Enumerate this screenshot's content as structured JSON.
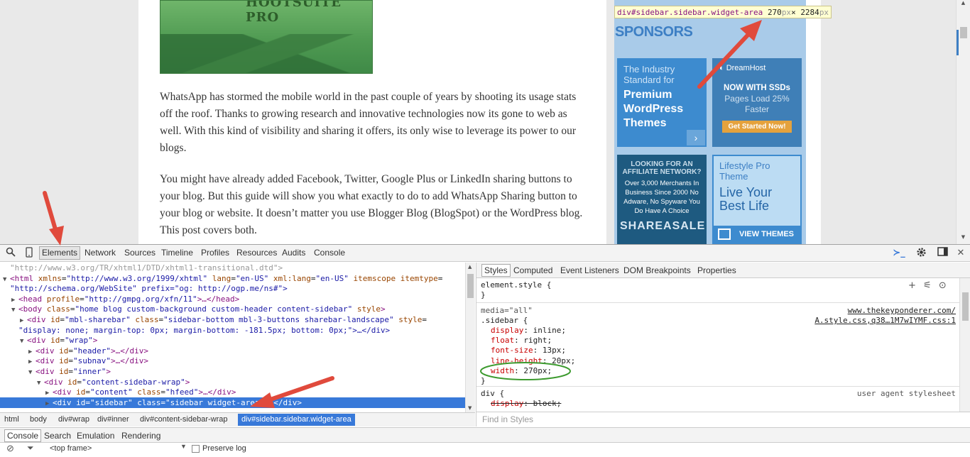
{
  "page": {
    "hero_text": "HOOTSUITE PRO",
    "paragraphs": [
      "WhatsApp has stormed the mobile world in the past couple of years by shooting its usage stats off the roof. Thanks to growing research and innovative technologies now its gone to web as well. With this kind of visibility and sharing it offers, its only wise to leverage its power to our blogs.",
      "You might have already added Facebook, Twitter, Google Plus or LinkedIn sharing buttons to your blog. But this guide will show you what exactly to do to add WhatsApp Sharing button to your blog or website. It doesn’t matter you use Blogger Blog (BlogSpot) or the WordPress blog. This post covers both."
    ],
    "tooltip": {
      "selector": "div#sidebar.sidebar.widget-area",
      "width": "270",
      "height": "2284",
      "unit": "px",
      "times": "×"
    },
    "sponsors_heading": "SPONSORS",
    "ads": {
      "ad1": {
        "t1": "The Industry Standard for",
        "t2": "Premium WordPress Themes",
        "arrow": "›"
      },
      "ad2": {
        "logo": "◐ DreamHost",
        "t1": "NOW WITH SSDs",
        "t2": "Pages Load 25% Faster",
        "btn": "Get Started Now!"
      },
      "ad3": {
        "t1": "LOOKING FOR AN AFFILIATE NETWORK?",
        "t2": "Over 3,000 Merchants In Business Since 2000 No Adware, No Spyware You Do Have A Choice",
        "t3": "SHAREASALE"
      },
      "ad4": {
        "t1": "Lifestyle Pro Theme",
        "t2": "Live Your Best Life",
        "bar": "VIEW THEMES"
      }
    }
  },
  "devtools": {
    "toolbar_tabs": [
      "Elements",
      "Network",
      "Sources",
      "Timeline",
      "Profiles",
      "Resources",
      "Audits",
      "Console"
    ],
    "icons": {
      "search": "search-icon",
      "device": "device-icon",
      "drawer": "console-drawer-icon",
      "settings": "gear-icon",
      "dock": "dock-icon",
      "close": "close-icon"
    },
    "dom_lines": [
      {
        "indent": 0,
        "tri": "",
        "text": "\"http://www.w3.org/TR/xhtml1/DTD/xhtml1-transitional.dtd\">",
        "dim": true
      },
      {
        "indent": 0,
        "tri": "▼",
        "tag": "<html",
        "attrs": [
          [
            "xmlns",
            "\"http://www.w3.org/1999/xhtml\""
          ],
          [
            "lang",
            "\"en-US\""
          ],
          [
            "xml:lang",
            "\"en-US\""
          ],
          [
            "itemscope",
            ""
          ],
          [
            "itemtype",
            "="
          ]
        ],
        "end": ""
      },
      {
        "indent": 0,
        "tri": "",
        "text": "\"http://schema.org/WebSite\" prefix=\"og: http://ogp.me/ns#\">",
        "valuecolor": true
      },
      {
        "indent": 1,
        "tri": "▶",
        "tag": "<head",
        "attrs": [
          [
            "profile",
            "\"http://gmpg.org/xfn/11\""
          ]
        ],
        "end": ">…</head>"
      },
      {
        "indent": 1,
        "tri": "▼",
        "tag": "<body",
        "attrs": [
          [
            "class",
            "\"home blog custom-background custom-header content-sidebar\""
          ],
          [
            "style",
            ""
          ]
        ],
        "end": ">"
      },
      {
        "indent": 2,
        "tri": "▶",
        "tag": "<div",
        "attrs": [
          [
            "id",
            "\"mbl-sharebar\""
          ],
          [
            "class",
            "\"sidebar-bottom mbl-3-buttons sharebar-landscape\""
          ],
          [
            "style",
            "="
          ]
        ],
        "end": ""
      },
      {
        "indent": 1,
        "tri": "",
        "text": "\"display: none; margin-top: 0px; margin-bottom: -181.5px; bottom: 0px;\">…</div>",
        "valuecolor": true
      },
      {
        "indent": 2,
        "tri": "▼",
        "tag": "<div",
        "attrs": [
          [
            "id",
            "\"wrap\""
          ]
        ],
        "end": ">"
      },
      {
        "indent": 3,
        "tri": "▶",
        "tag": "<div",
        "attrs": [
          [
            "id",
            "\"header\""
          ]
        ],
        "end": ">…</div>"
      },
      {
        "indent": 3,
        "tri": "▶",
        "tag": "<div",
        "attrs": [
          [
            "id",
            "\"subnav\""
          ]
        ],
        "end": ">…</div>"
      },
      {
        "indent": 3,
        "tri": "▼",
        "tag": "<div",
        "attrs": [
          [
            "id",
            "\"inner\""
          ]
        ],
        "end": ">"
      },
      {
        "indent": 4,
        "tri": "▼",
        "tag": "<div",
        "attrs": [
          [
            "id",
            "\"content-sidebar-wrap\""
          ]
        ],
        "end": ">"
      },
      {
        "indent": 5,
        "tri": "▶",
        "tag": "<div",
        "attrs": [
          [
            "id",
            "\"content\""
          ],
          [
            "class",
            "\"hfeed\""
          ]
        ],
        "end": ">…</div>"
      },
      {
        "indent": 5,
        "tri": "▶",
        "tag": "<div",
        "attrs": [
          [
            "id",
            "\"sidebar\""
          ],
          [
            "class",
            "\"sidebar widget-area\""
          ]
        ],
        "end": ">…</div>",
        "selected": true
      }
    ],
    "breadcrumbs": [
      "html",
      "body",
      "div#wrap",
      "div#inner",
      "div#content-sidebar-wrap",
      "div#sidebar.sidebar.widget-area"
    ],
    "styles_tabs": [
      "Styles",
      "Computed",
      "Event Listeners",
      "DOM Breakpoints",
      "Properties"
    ],
    "element_style": {
      "selector": "element.style {",
      "close": "}"
    },
    "rule1": {
      "media": "media=\"all\"",
      "source1": "www.thekeyponderer.com/",
      "source2": "A.style.css,q38…1M7wIYMF.css:1",
      "selector": ".sidebar {",
      "props": [
        [
          "display",
          "inline"
        ],
        [
          "float",
          "right"
        ],
        [
          "font-size",
          "13px"
        ],
        [
          "line-height",
          "20px"
        ],
        [
          "width",
          "270px"
        ]
      ],
      "close": "}"
    },
    "rule2": {
      "selector": "div {",
      "source": "user agent stylesheet",
      "prop": [
        "display",
        "block"
      ]
    },
    "find_placeholder": "Find in Styles",
    "drawer_tabs": [
      "Console",
      "Search",
      "Emulation",
      "Rendering"
    ],
    "console": {
      "frame": "<top frame>",
      "preserve_log": "Preserve log"
    }
  },
  "colors": {
    "selection": "#3879d9",
    "annotation_arrow": "#e04a3c",
    "annotation_ellipse": "#3c9a2e"
  }
}
